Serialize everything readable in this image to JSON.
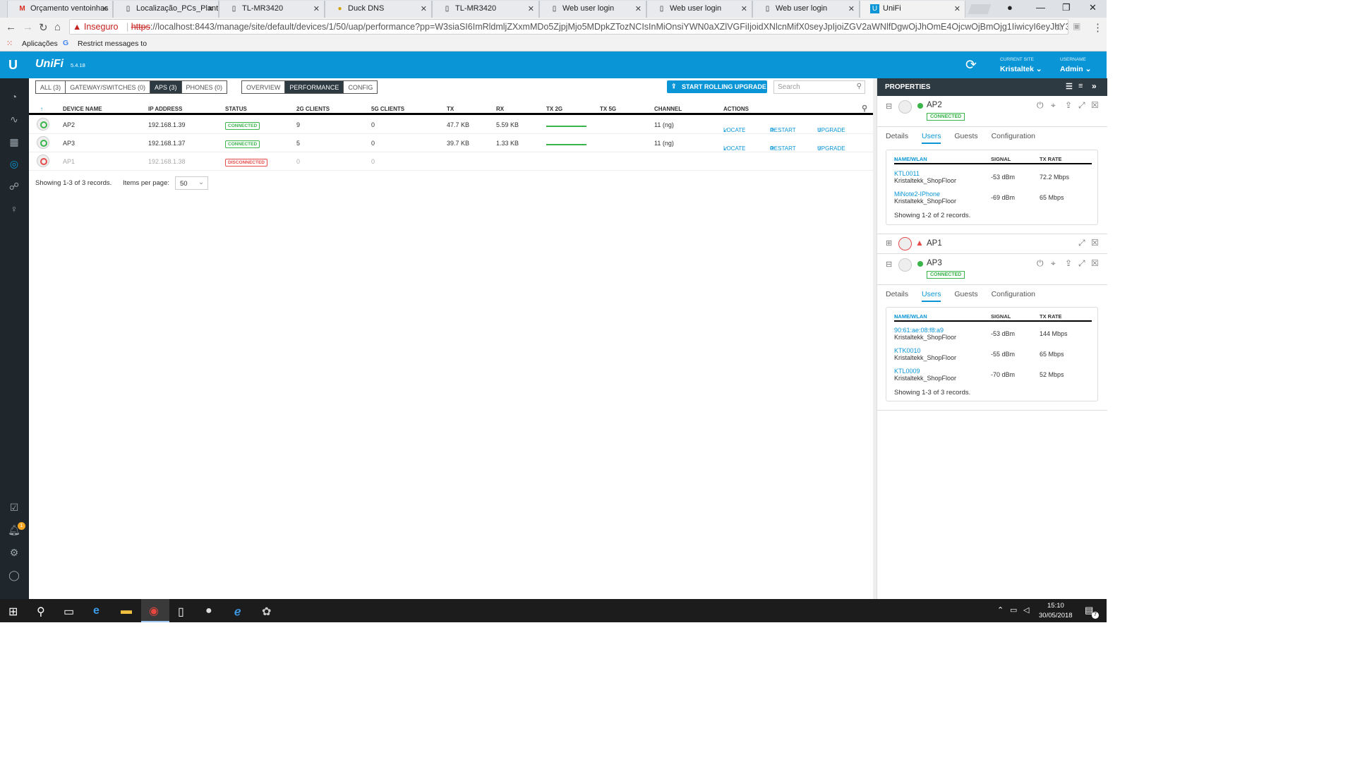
{
  "browser": {
    "tabs": [
      {
        "title": "Orçamento ventoinhas",
        "icon": "gmail-icon"
      },
      {
        "title": "Localização_PCs_Planta",
        "icon": "doc-icon"
      },
      {
        "title": "TL-MR3420",
        "icon": "doc-icon"
      },
      {
        "title": "Duck DNS",
        "icon": "duck-icon"
      },
      {
        "title": "TL-MR3420",
        "icon": "doc-icon"
      },
      {
        "title": "Web user login",
        "icon": "doc-icon"
      },
      {
        "title": "Web user login",
        "icon": "doc-icon"
      },
      {
        "title": "Web user login",
        "icon": "doc-icon"
      },
      {
        "title": "UniFi",
        "icon": "unifi-icon"
      }
    ],
    "security_label": "Inseguro",
    "url_scheme": "https",
    "url_rest": "://localhost:8443/manage/site/default/devices/1/50/uap/performance?pp=W3siaSI6ImRldmljZXxmMDo5ZjpjMjo5MDpkZTozNCIsInMiOnsiYWN0aXZlVGFiIjoidXNlcnMifX0seyJpIjoiZGV2aWNlfDgwOjJhOmE4OjcwOjBmOjg1IiwicyI6eyJhY3RpdmVUYWIiOiJjb...",
    "bookmarks": [
      "Aplicações",
      "Restrict messages to"
    ]
  },
  "app": {
    "name": "UniFi",
    "version": "5.4.18",
    "current_site_label": "CURRENT SITE",
    "current_site": "Kristaltek",
    "username_label": "USERNAME",
    "username": "Admin"
  },
  "filters": {
    "device_types": [
      "ALL (3)",
      "GATEWAY/SWITCHES (0)",
      "APS (3)",
      "PHONES (0)"
    ],
    "views": [
      "OVERVIEW",
      "PERFORMANCE",
      "CONFIG"
    ],
    "rolling_upgrade": "START ROLLING UPGRADE",
    "search_placeholder": "Search"
  },
  "table": {
    "headers": [
      "DEVICE NAME",
      "IP ADDRESS",
      "STATUS",
      "2G CLIENTS",
      "5G CLIENTS",
      "TX",
      "RX",
      "TX 2G",
      "TX 5G",
      "CHANNEL",
      "ACTIONS"
    ],
    "rows": [
      {
        "name": "AP2",
        "ip": "192.168.1.39",
        "status": "CONNECTED",
        "c2g": "9",
        "c5g": "0",
        "tx": "47.7 KB",
        "rx": "5.59 KB",
        "channel": "11 (ng)"
      },
      {
        "name": "AP3",
        "ip": "192.168.1.37",
        "status": "CONNECTED",
        "c2g": "5",
        "c5g": "0",
        "tx": "39.7 KB",
        "rx": "1.33 KB",
        "channel": "11 (ng)"
      },
      {
        "name": "AP1",
        "ip": "192.168.1.38",
        "status": "DISCONNECTED",
        "c2g": "0",
        "c5g": "0",
        "tx": "",
        "rx": "",
        "channel": ""
      }
    ],
    "actions": [
      "LOCATE",
      "RESTART",
      "UPGRADE"
    ],
    "footer": "Showing 1-3 of 3 records.",
    "per_page_label": "Items per page:",
    "per_page": "50"
  },
  "properties": {
    "title": "PROPERTIES",
    "tabs": [
      "Details",
      "Users",
      "Guests",
      "Configuration"
    ],
    "user_headers": [
      "NAME/WLAN",
      "SIGNAL",
      "TX RATE"
    ],
    "ap2": {
      "name": "AP2",
      "status": "CONNECTED",
      "users": [
        {
          "name": "KTL0011",
          "wlan": "Kristaltekk_ShopFloor",
          "signal": "-53 dBm",
          "rate": "72.2 Mbps"
        },
        {
          "name": "MiNote2-IPhone",
          "wlan": "Kristaltekk_ShopFloor",
          "signal": "-69 dBm",
          "rate": "65 Mbps"
        }
      ],
      "footer": "Showing 1-2 of 2 records."
    },
    "ap1": {
      "name": "AP1"
    },
    "ap3": {
      "name": "AP3",
      "status": "CONNECTED",
      "users": [
        {
          "name": "90:61:ae:08:f8:a9",
          "wlan": "Kristaltekk_ShopFloor",
          "signal": "-53 dBm",
          "rate": "144 Mbps"
        },
        {
          "name": "KTK0010",
          "wlan": "Kristaltekk_ShopFloor",
          "signal": "-55 dBm",
          "rate": "65 Mbps"
        },
        {
          "name": "KTL0009",
          "wlan": "Kristaltekk_ShopFloor",
          "signal": "-70 dBm",
          "rate": "52 Mbps"
        }
      ],
      "footer": "Showing 1-3 of 3 records."
    }
  },
  "notifications_count": "1",
  "taskbar": {
    "time": "15:10",
    "date": "30/05/2018",
    "action_center_count": "7"
  },
  "colors": {
    "brand": "#0a96d6",
    "connected": "#3ab54a",
    "disconnected": "#e54b4b"
  }
}
